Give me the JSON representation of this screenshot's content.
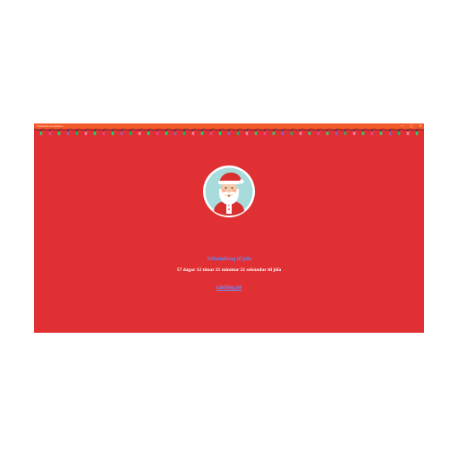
{
  "window": {
    "title": "Christmas Countdown",
    "controls": [
      "—",
      "▢",
      "✕"
    ]
  },
  "lights": {
    "colors": [
      "#2ecc71",
      "#e84393",
      "#2ecc71",
      "#9b59b6",
      "#27ae60",
      "#fd79a8"
    ]
  },
  "avatar": {
    "icon": "santa-claus-icon",
    "bg_color": "#a8dcdc",
    "ring_color": "#ffffff"
  },
  "main": {
    "heading": "Niðurtalning til jóla",
    "countdown": "57 dagar 12 tímar 21 mínútur 21 sekúndur til jóla",
    "link": "Gleðileg jól"
  },
  "colors": {
    "background": "#e03033",
    "titlebar": "#f25a2a",
    "heading": "#5b8cff",
    "countdown": "#ffffff"
  }
}
